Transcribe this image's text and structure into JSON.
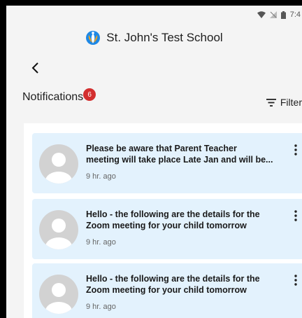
{
  "status_bar": {
    "time": "7:4",
    "icons": [
      "wifi-icon",
      "signal-off-icon",
      "battery-icon"
    ]
  },
  "header": {
    "logo_icon": "school-logo-icon",
    "school_name": "St. John's Test School"
  },
  "nav": {
    "back_icon": "chevron-left-icon"
  },
  "notifications": {
    "title": "Notifications",
    "badge_count": "6",
    "filter_label": "Filter",
    "items": [
      {
        "message": "Please be aware that Parent Teacher\nmeeting will take place Late Jan and will be...",
        "time": "9 hr. ago"
      },
      {
        "message": "Hello - the following are the details for the\nZoom meeting for your child tomorrow",
        "time": "9 hr. ago"
      },
      {
        "message": "Hello - the following are the details for the\nZoom meeting for your child tomorrow",
        "time": "9 hr. ago"
      }
    ]
  },
  "colors": {
    "card_background": "#e3f2fd",
    "badge": "#d32f2f",
    "logo_blue": "#1e88e5",
    "logo_orange": "#f4a21b"
  }
}
